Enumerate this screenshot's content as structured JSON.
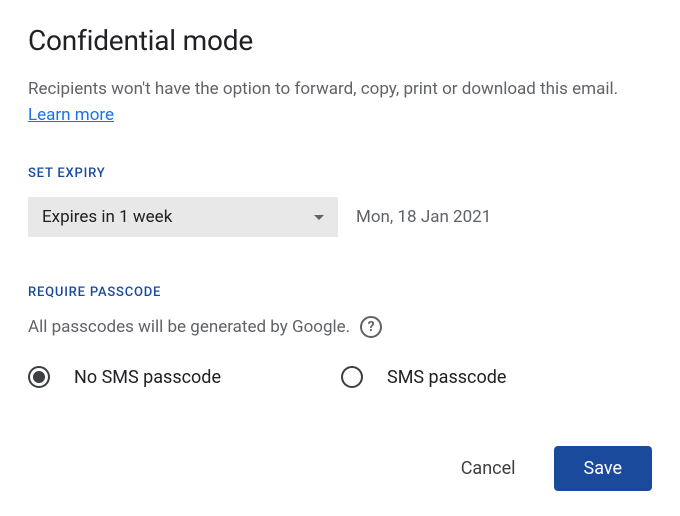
{
  "title": "Confidential mode",
  "description": {
    "text": "Recipients won't have the option to forward, copy, print or download this email. ",
    "learn_more": "Learn more"
  },
  "expiry": {
    "section_label": "SET EXPIRY",
    "selected": "Expires in 1 week",
    "date": "Mon, 18 Jan 2021"
  },
  "passcode": {
    "section_label": "REQUIRE PASSCODE",
    "hint": "All passcodes will be generated by Google.",
    "options": {
      "no_sms": {
        "label": "No SMS passcode",
        "selected": true
      },
      "sms": {
        "label": "SMS passcode",
        "selected": false
      }
    }
  },
  "buttons": {
    "cancel": "Cancel",
    "save": "Save"
  }
}
